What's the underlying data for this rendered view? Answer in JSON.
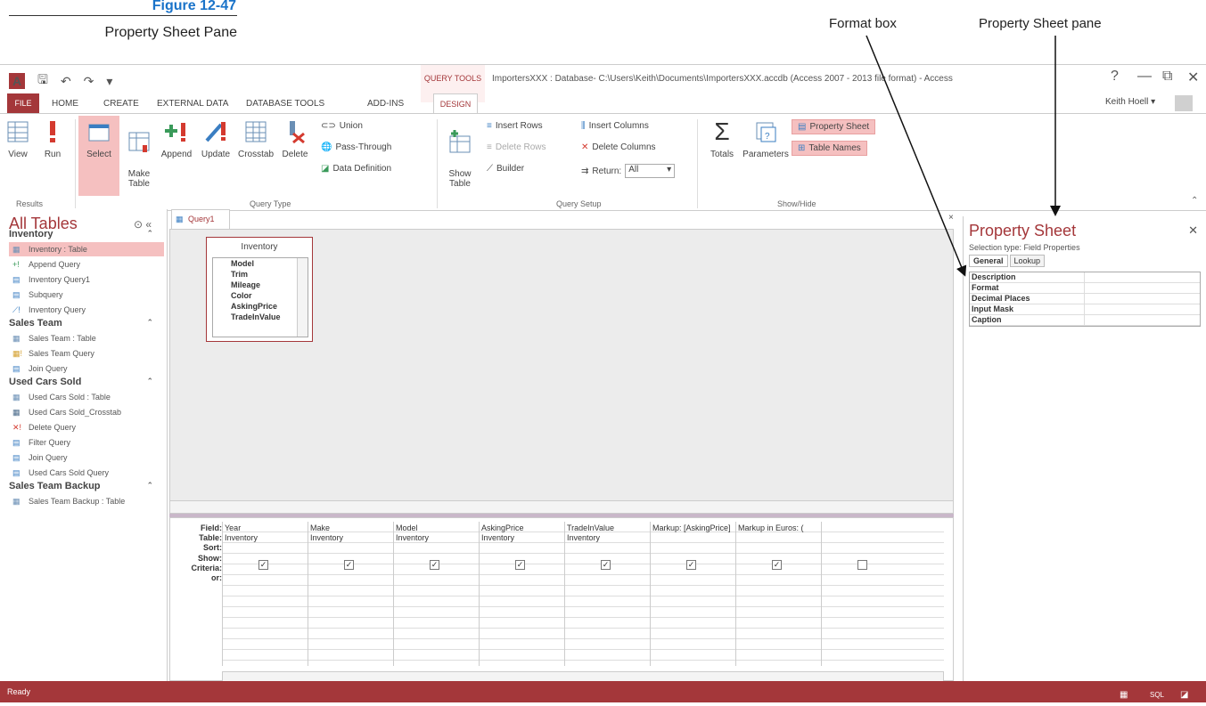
{
  "figure": {
    "title": "Figure 12-47",
    "caption": "Property Sheet Pane",
    "callout_format": "Format box",
    "callout_ps": "Property Sheet pane"
  },
  "window": {
    "context_tab": "QUERY TOOLS",
    "title": "ImportersXXX : Database- C:\\Users\\Keith\\Documents\\ImportersXXX.accdb (Access 2007 - 2013 file format) - Access",
    "help": "?",
    "minimize": "—",
    "restore": "⧉",
    "close": "✕",
    "user": "Keith Hoell ▾"
  },
  "ribbon_tabs": [
    "FILE",
    "HOME",
    "CREATE",
    "EXTERNAL DATA",
    "DATABASE TOOLS",
    "ADD-INS",
    "DESIGN"
  ],
  "ribbon": {
    "results": {
      "view": "View",
      "run": "Run",
      "group": "Results"
    },
    "query_type": {
      "select": "Select",
      "make_table": "Make\nTable",
      "append": "Append",
      "update": "Update",
      "crosstab": "Crosstab",
      "delete": "Delete",
      "union": "Union",
      "pass_through": "Pass-Through",
      "data_definition": "Data Definition",
      "group": "Query Type"
    },
    "query_setup": {
      "show_table": "Show\nTable",
      "insert_rows": "Insert Rows",
      "delete_rows": "Delete Rows",
      "builder": "Builder",
      "insert_columns": "Insert Columns",
      "delete_columns": "Delete Columns",
      "return_label": "Return:",
      "return_value": "All",
      "group": "Query Setup"
    },
    "show_hide": {
      "totals": "Totals",
      "parameters": "Parameters",
      "property_sheet": "Property Sheet",
      "table_names": "Table Names",
      "group": "Show/Hide"
    }
  },
  "nav": {
    "title": "All Tables",
    "sections": [
      {
        "name": "Inventory",
        "items": [
          {
            "label": "Inventory : Table",
            "type": "table",
            "selected": true
          },
          {
            "label": "Append Query",
            "type": "append"
          },
          {
            "label": "Inventory Query1",
            "type": "select"
          },
          {
            "label": "Subquery",
            "type": "select"
          },
          {
            "label": "Inventory Query",
            "type": "update"
          }
        ]
      },
      {
        "name": "Sales Team",
        "items": [
          {
            "label": "Sales Team : Table",
            "type": "table"
          },
          {
            "label": "Sales Team Query",
            "type": "maketable"
          },
          {
            "label": "Join Query",
            "type": "select"
          }
        ]
      },
      {
        "name": "Used Cars Sold",
        "items": [
          {
            "label": "Used Cars Sold : Table",
            "type": "table"
          },
          {
            "label": "Used Cars Sold_Crosstab",
            "type": "crosstab"
          },
          {
            "label": "Delete Query",
            "type": "delete"
          },
          {
            "label": "Filter Query",
            "type": "select"
          },
          {
            "label": "Join Query",
            "type": "select"
          },
          {
            "label": "Used Cars Sold Query",
            "type": "select"
          }
        ]
      },
      {
        "name": "Sales Team Backup",
        "items": [
          {
            "label": "Sales Team Backup : Table",
            "type": "table"
          }
        ]
      }
    ]
  },
  "query_tab": "Query1",
  "table_box": {
    "name": "Inventory",
    "fields": [
      "Model",
      "Trim",
      "Mileage",
      "Color",
      "AskingPrice",
      "TradeInValue"
    ]
  },
  "grid": {
    "row_labels": [
      "Field:",
      "Table:",
      "Sort:",
      "Show:",
      "Criteria:",
      "or:"
    ],
    "columns": [
      {
        "field": "Year",
        "table": "Inventory",
        "show": true
      },
      {
        "field": "Make",
        "table": "Inventory",
        "show": true
      },
      {
        "field": "Model",
        "table": "Inventory",
        "show": true
      },
      {
        "field": "AskingPrice",
        "table": "Inventory",
        "show": true
      },
      {
        "field": "TradeInValue",
        "table": "Inventory",
        "show": true
      },
      {
        "field": "Markup: [AskingPrice]",
        "table": "",
        "show": true
      },
      {
        "field": "Markup in Euros: (",
        "table": "",
        "show": true
      },
      {
        "field": "",
        "table": "",
        "show": false
      }
    ]
  },
  "property_sheet": {
    "title": "Property Sheet",
    "selection_type": "Selection type:  Field Properties",
    "tabs": [
      "General",
      "Lookup"
    ],
    "rows": [
      "Description",
      "Format",
      "Decimal Places",
      "Input Mask",
      "Caption"
    ]
  },
  "status": "Ready"
}
